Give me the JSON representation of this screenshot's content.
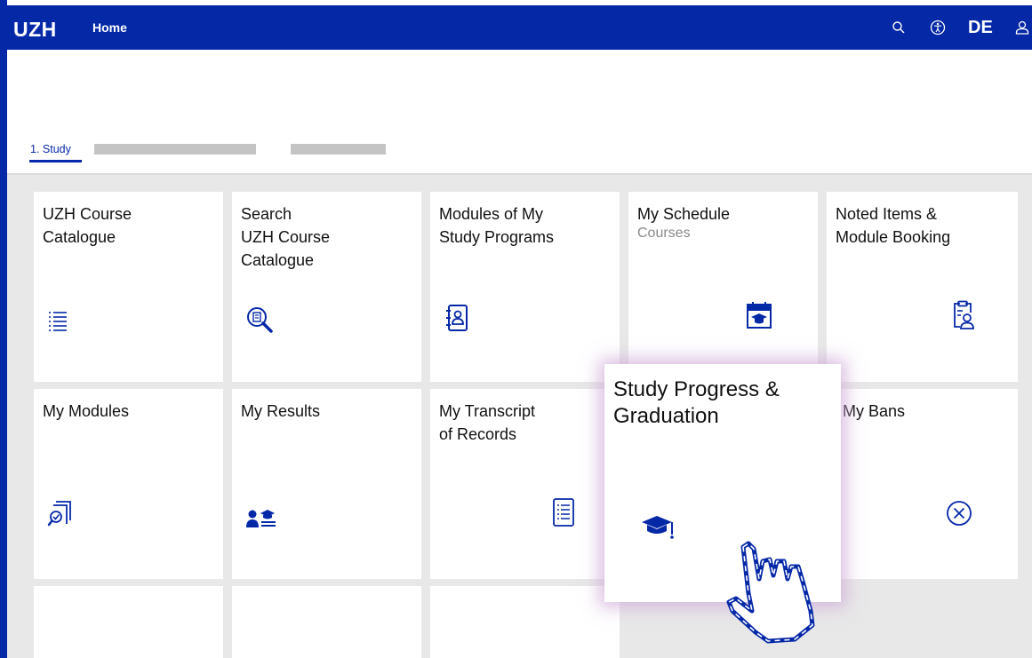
{
  "header": {
    "logo": "UZH",
    "home_label": "Home",
    "language_label": "DE",
    "icons": [
      "search-icon",
      "accessibility-icon",
      "user-icon"
    ]
  },
  "tabs": {
    "active_label": "1. Study"
  },
  "tiles": [
    {
      "title": "UZH Course\nCatalogue",
      "icon": "list-icon"
    },
    {
      "title": "Search\nUZH Course\nCatalogue",
      "icon": "search-catalogue-icon"
    },
    {
      "title": "Modules of My\nStudy Programs",
      "icon": "contacts-book-icon"
    },
    {
      "title": "My Schedule",
      "subtitle": "Courses",
      "icon": "calendar-graduation-icon"
    },
    {
      "title": "Noted Items &\nModule Booking",
      "icon": "clipboard-user-icon"
    },
    {
      "title": "My Modules",
      "icon": "modules-search-icon"
    },
    {
      "title": "My Results",
      "icon": "student-results-icon"
    },
    {
      "title": "My Transcript\nof Records",
      "icon": "document-list-icon"
    },
    {
      "title": "My Bans",
      "icon": "circle-x-icon"
    }
  ],
  "featured_tile": {
    "title": "Study Progress &\nGraduation",
    "icon": "graduation-cap-icon"
  },
  "colors": {
    "brand": "#0528a7",
    "background": "#e8e8e8",
    "subtitle": "#8a8a8a"
  }
}
